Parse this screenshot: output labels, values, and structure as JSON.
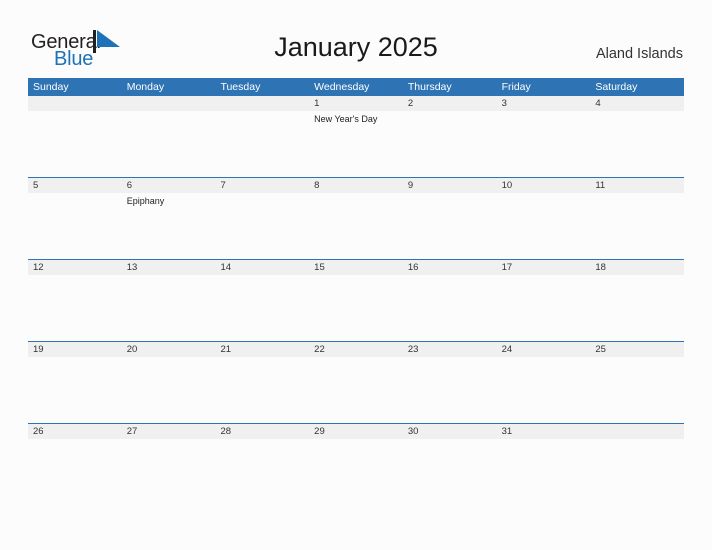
{
  "brand": {
    "word_one": "General",
    "word_two": "Blue",
    "mark": "triangle-flag-mark",
    "color_dark": "#231f20",
    "color_blue": "#1d72b8"
  },
  "header": {
    "title": "January 2025",
    "location": "Aland Islands"
  },
  "theme": {
    "header_blue": "#2e73b4",
    "band_gray": "#f0f0f0",
    "page_background": "#fcfcfc",
    "separator_blue": "#2e73b4"
  },
  "calendar": {
    "weekdays": [
      "Sunday",
      "Monday",
      "Tuesday",
      "Wednesday",
      "Thursday",
      "Friday",
      "Saturday"
    ],
    "weeks": [
      {
        "days": [
          {
            "date": "",
            "event": ""
          },
          {
            "date": "",
            "event": ""
          },
          {
            "date": "",
            "event": ""
          },
          {
            "date": "1",
            "event": "New Year's Day"
          },
          {
            "date": "2",
            "event": ""
          },
          {
            "date": "3",
            "event": ""
          },
          {
            "date": "4",
            "event": ""
          }
        ]
      },
      {
        "days": [
          {
            "date": "5",
            "event": ""
          },
          {
            "date": "6",
            "event": "Epiphany"
          },
          {
            "date": "7",
            "event": ""
          },
          {
            "date": "8",
            "event": ""
          },
          {
            "date": "9",
            "event": ""
          },
          {
            "date": "10",
            "event": ""
          },
          {
            "date": "11",
            "event": ""
          }
        ]
      },
      {
        "days": [
          {
            "date": "12",
            "event": ""
          },
          {
            "date": "13",
            "event": ""
          },
          {
            "date": "14",
            "event": ""
          },
          {
            "date": "15",
            "event": ""
          },
          {
            "date": "16",
            "event": ""
          },
          {
            "date": "17",
            "event": ""
          },
          {
            "date": "18",
            "event": ""
          }
        ]
      },
      {
        "days": [
          {
            "date": "19",
            "event": ""
          },
          {
            "date": "20",
            "event": ""
          },
          {
            "date": "21",
            "event": ""
          },
          {
            "date": "22",
            "event": ""
          },
          {
            "date": "23",
            "event": ""
          },
          {
            "date": "24",
            "event": ""
          },
          {
            "date": "25",
            "event": ""
          }
        ]
      },
      {
        "days": [
          {
            "date": "26",
            "event": ""
          },
          {
            "date": "27",
            "event": ""
          },
          {
            "date": "28",
            "event": ""
          },
          {
            "date": "29",
            "event": ""
          },
          {
            "date": "30",
            "event": ""
          },
          {
            "date": "31",
            "event": ""
          },
          {
            "date": "",
            "event": ""
          }
        ]
      }
    ]
  }
}
